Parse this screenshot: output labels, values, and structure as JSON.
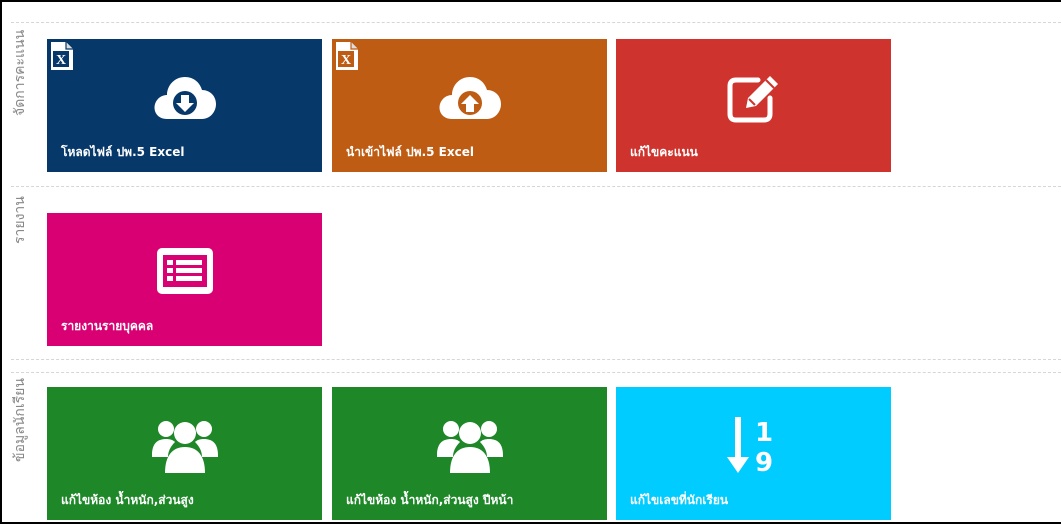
{
  "sections": [
    {
      "label": "จัดการคะแนน",
      "tiles": [
        {
          "label": "โหลดไฟล์ ปพ.5 Excel",
          "color": "#06386a",
          "icon": "cloud-download-icon",
          "badge": "excel-file-icon"
        },
        {
          "label": "นำเข้าไฟล์ ปพ.5 Excel",
          "color": "#bf5c14",
          "icon": "cloud-upload-icon",
          "badge": "excel-file-icon"
        },
        {
          "label": "แก้ไขคะแนน",
          "color": "#cf332d",
          "icon": "edit-icon"
        }
      ]
    },
    {
      "label": "รายงาน",
      "tiles": [
        {
          "label": "รายงานรายบุคคล",
          "color": "#d80073",
          "icon": "list-icon"
        }
      ]
    },
    {
      "label": "ข้อมูลนักเรียน",
      "tiles": [
        {
          "label": "แก้ไขห้อง น้ำหนัก,ส่วนสูง",
          "color": "#1e8728",
          "icon": "users-icon"
        },
        {
          "label": "แก้ไขห้อง น้ำหนัก,ส่วนสูง ปีหน้า",
          "color": "#1e8728",
          "icon": "users-icon"
        },
        {
          "label": "แก้ไขเลขที่นักเรียน",
          "color": "#00ccff",
          "icon": "sort-numeric-icon"
        }
      ]
    }
  ]
}
